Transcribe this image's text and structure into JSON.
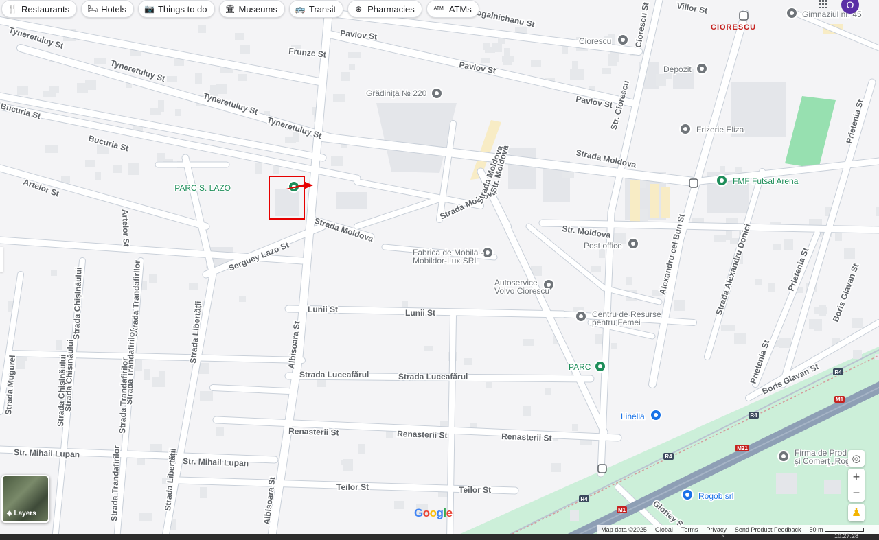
{
  "chips": [
    {
      "label": "Restaurants",
      "icon": "fork-knife-icon",
      "glyph": "🍴"
    },
    {
      "label": "Hotels",
      "icon": "bed-icon",
      "glyph": "🛏"
    },
    {
      "label": "Things to do",
      "icon": "camera-icon",
      "glyph": "📷"
    },
    {
      "label": "Museums",
      "icon": "museum-icon",
      "glyph": "🏛"
    },
    {
      "label": "Transit",
      "icon": "bus-icon",
      "glyph": "🚌"
    },
    {
      "label": "Pharmacies",
      "icon": "pharmacy-icon",
      "glyph": "⊕"
    },
    {
      "label": "ATMs",
      "icon": "atm-icon",
      "glyph": "ATM"
    }
  ],
  "user": {
    "avatar_letter": "O"
  },
  "streets": {
    "tyneretuluy1": "Tyneretuluy St",
    "tyneretuluy2": "Tyneretuluy St",
    "tyneretuluy3": "Tyneretuluy St",
    "tyneretuluy4": "Tyneretuluy St",
    "frunze": "Frunze St",
    "pavlov1": "Pavlov St",
    "pavlov2": "Pavlov St",
    "pavlov3": "Pavlov St",
    "kogalnichanu": "Kogalnichanu St",
    "bucuria1": "Bucuria St",
    "bucuria2": "Bucuria St",
    "artelor": "Artelor St",
    "artelor_v": "Artelor St",
    "serguey": "Serguey Lazo St",
    "moldova1": "Strada Moldova",
    "moldova2": "Strada Moldova",
    "moldova3": "Strada Moldova",
    "moldova4": "Strada Moldova",
    "str_moldova_v": "Str. Moldova",
    "str_moldova_h": "Str. Moldova",
    "str_ciorescu1": "Str. Ciorescu",
    "str_ciorescu2": "Ciorescu St",
    "alexandru": "Alexandru cel Bun St",
    "alexandru_donici": "Strada Alexandru Donici",
    "prietenia1": "Prietenia St",
    "prietenia2": "Prietenia St",
    "prietenia3": "Prietenia St",
    "boris1": "Boris Glavan St",
    "boris2": "Boris Glavan St",
    "lunii1": "Lunii St",
    "lunii2": "Lunii St",
    "luceafarul1": "Strada Luceafărul",
    "luceafarul2": "Strada Luceafărul",
    "renasterii1": "Renasterii St",
    "renasterii2": "Renasterii St",
    "renasterii3": "Renasterii St",
    "teilor1": "Teilor St",
    "teilor2": "Teilor St",
    "albisoara1": "Albisoara St",
    "albisoara2": "Albisoara St",
    "mihail1": "Str. Mihail Lupan",
    "mihail2": "Str. Mihail Lupan",
    "chisinaului1": "Strada Chișinăului",
    "chisinaului2": "Strada Chișinăului",
    "chisinaului3": "Strada Chișinăului",
    "trandafirilor1": "Strada Trandafirilor",
    "trandafirilor2": "Strada Trandafirilor",
    "trandafirilor3": "Strada Trandafirilor",
    "trandafirilor4": "Strada Trandafirilor",
    "libertatii1": "Strada Libertății",
    "libertatii2": "Strada Libertății",
    "mugurel": "Strada Mugurel",
    "viilor": "Viilor St",
    "gloriey": "Gloriey S"
  },
  "road_badges": [
    "R4",
    "R4",
    "R4",
    "R4",
    "M1",
    "M1",
    "M21"
  ],
  "places": {
    "parc_lazo": "PARC S. LAZO",
    "gradinita": "Grădiniță № 220",
    "ciorescu_poi": "Ciorescu",
    "depozit": "Depozit",
    "frizerie": "Frizerie Eliza",
    "fmf": "FMF Futsal Arena",
    "gimnaziul": "Gimnaziul nr. 45",
    "district": "CIORESCU",
    "fabrica1": "Fabrica de Mobilă -",
    "fabrica2": "Mobildor-Lux SRL",
    "post": "Post office",
    "autoservice1": "Autoservice",
    "autoservice2": "Volvo Ciorescu",
    "centru1": "Centru de Resurse",
    "centru2": "pentru Femei",
    "parc": "PARC",
    "linella": "Linella",
    "rogob": "Rogob srl",
    "firma1": "Firma de Prod",
    "firma2": "și Comerț „Rog"
  },
  "layers_label": "Layers",
  "google_logo": "Google",
  "footer": {
    "map_data": "Map data ©2025",
    "global": "Global",
    "terms": "Terms",
    "privacy": "Privacy",
    "feedback": "Send Product Feedback",
    "scale": "50 m"
  },
  "clock": "10:27:28",
  "colors": {
    "road": "#ffffff",
    "road_casing": "#c9d0d9",
    "highway": "#8e9fb5",
    "building": "#e3e5e8",
    "park": "#bff0d0",
    "field": "#97e0b0",
    "highlight": "#e60000",
    "green_poi": "#1e8e5a",
    "gray_poi": "#70757a",
    "blue_poi": "#1a73e8"
  }
}
